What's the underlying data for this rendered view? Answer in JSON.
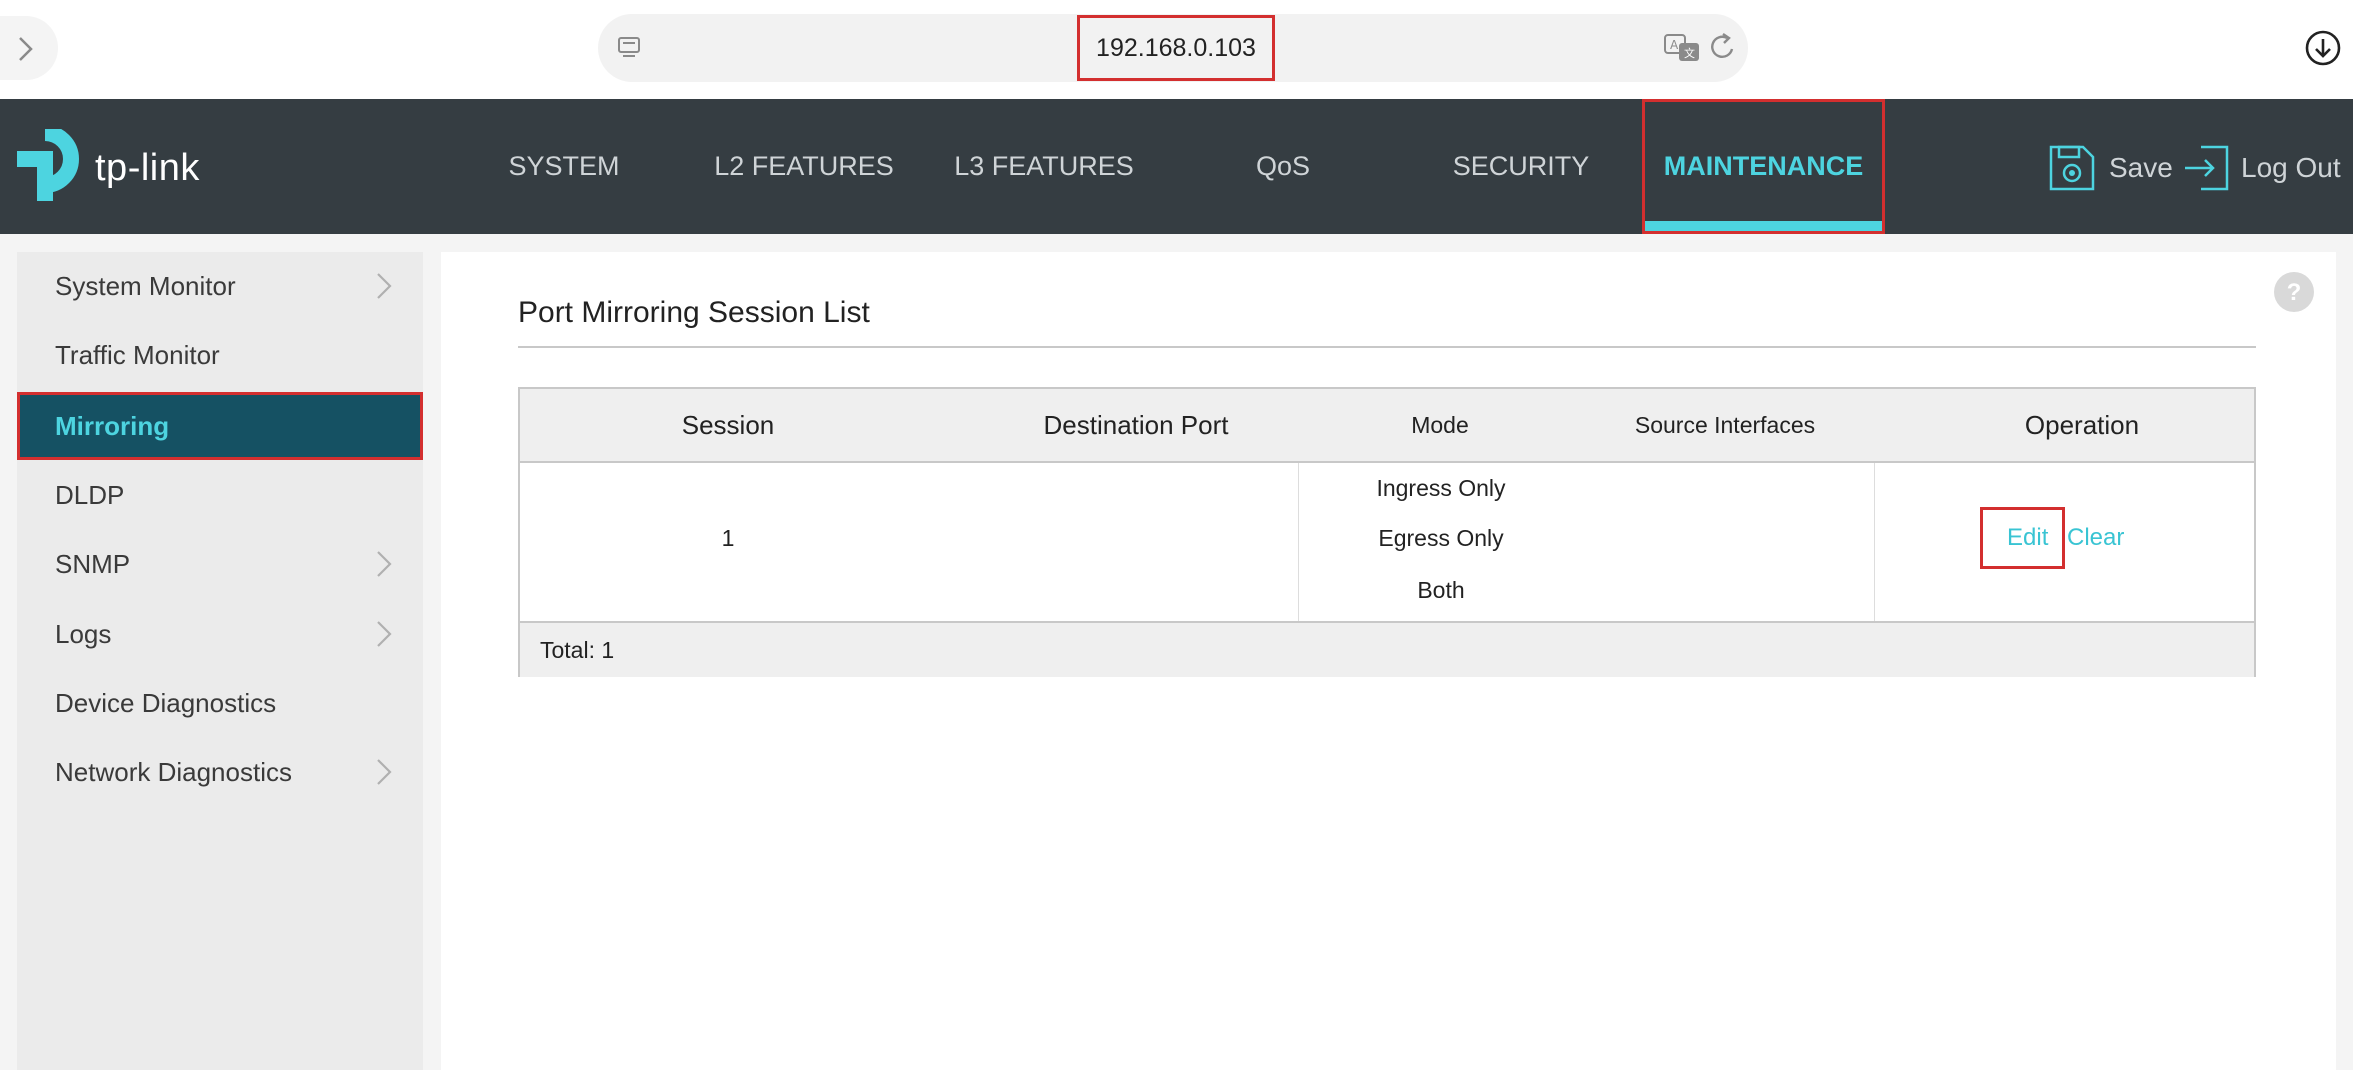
{
  "browser": {
    "url": "192.168.0.103"
  },
  "brand": {
    "logo_text": "tp-link"
  },
  "topnav": {
    "items": [
      {
        "label": "SYSTEM"
      },
      {
        "label": "L2 FEATURES"
      },
      {
        "label": "L3 FEATURES"
      },
      {
        "label": "QoS"
      },
      {
        "label": "SECURITY"
      },
      {
        "label": "MAINTENANCE",
        "active": true
      }
    ],
    "save_label": "Save",
    "logout_label": "Log Out"
  },
  "sidebar": {
    "items": [
      {
        "label": "System Monitor",
        "has_submenu": true
      },
      {
        "label": "Traffic Monitor",
        "has_submenu": false
      },
      {
        "label": "Mirroring",
        "active": true
      },
      {
        "label": "DLDP",
        "has_submenu": false
      },
      {
        "label": "SNMP",
        "has_submenu": true
      },
      {
        "label": "Logs",
        "has_submenu": true
      },
      {
        "label": "Device Diagnostics",
        "has_submenu": false
      },
      {
        "label": "Network Diagnostics",
        "has_submenu": true
      }
    ]
  },
  "main": {
    "title": "Port Mirroring Session List",
    "table": {
      "headers": {
        "session": "Session",
        "destination_port": "Destination Port",
        "mode": "Mode",
        "source_interfaces": "Source Interfaces",
        "operation": "Operation"
      },
      "rows": [
        {
          "session": "1",
          "destination_port": "",
          "modes": [
            "Ingress Only",
            "Egress Only",
            "Both"
          ],
          "source_interfaces": [
            "",
            "",
            ""
          ],
          "edit_label": "Edit",
          "clear_label": "Clear"
        }
      ],
      "total_label": "Total: 1"
    }
  },
  "colors": {
    "accent": "#4dd4e0",
    "nav_bg": "#353d42",
    "sidebar_active_bg": "#155163",
    "highlight_border": "#d32f2f",
    "link": "#39c4d3"
  },
  "icons": {
    "forward": "chevron-right-icon",
    "tab": "tab-icon",
    "translate": "translate-icon",
    "reload": "reload-icon",
    "download": "download-icon",
    "save": "save-gear-icon",
    "logout": "logout-icon",
    "help": "help-icon",
    "submenu": "chevron-right-icon"
  }
}
